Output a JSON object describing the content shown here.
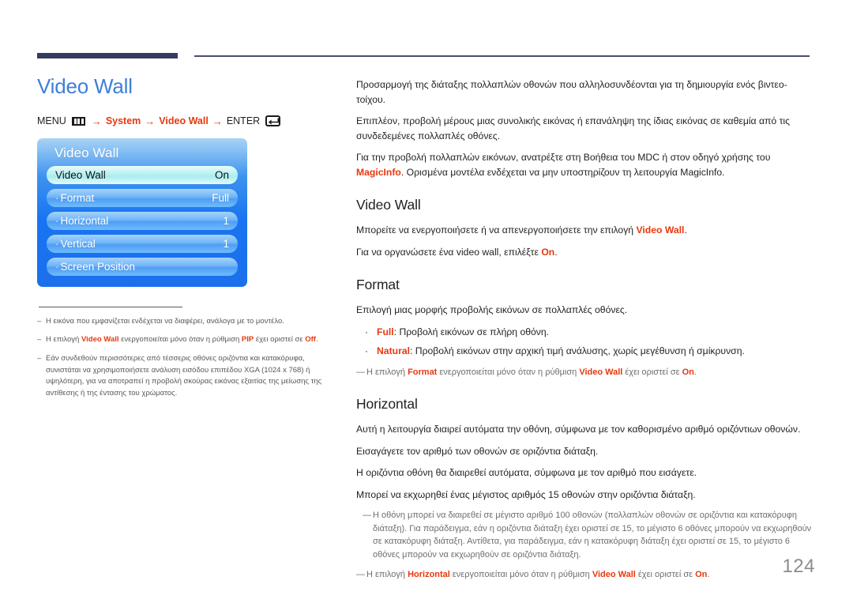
{
  "page": {
    "number": "124",
    "title": "Video Wall",
    "accent_blue": "#3f7fd8",
    "accent_red": "#e8380d",
    "rule_navy": "#353b5e"
  },
  "breadcrumb": {
    "menu_label": "MENU",
    "menu_icon": "menu-bars-icon",
    "arrow": "→",
    "system_label": "System",
    "videowall_label": "Video Wall",
    "enter_label": "ENTER",
    "enter_icon": "enter-return-icon"
  },
  "osd": {
    "title": "Video Wall",
    "rows": [
      {
        "label": "Video Wall",
        "value": "On",
        "selected": true,
        "prefix": ""
      },
      {
        "label": "Format",
        "value": "Full",
        "selected": false,
        "prefix": "·"
      },
      {
        "label": "Horizontal",
        "value": "1",
        "selected": false,
        "prefix": "·"
      },
      {
        "label": "Vertical",
        "value": "1",
        "selected": false,
        "prefix": "·"
      },
      {
        "label": "Screen Position",
        "value": "",
        "selected": false,
        "prefix": "·"
      }
    ]
  },
  "left_footnotes": [
    {
      "dash": "–",
      "parts": [
        {
          "t": "Η εικόνα που εμφανίζεται ενδέχεται να διαφέρει, ανάλογα με το μοντέλο.",
          "hl": false
        }
      ]
    },
    {
      "dash": "–",
      "parts": [
        {
          "t": "Η επιλογή ",
          "hl": false
        },
        {
          "t": "Video Wall",
          "hl": true
        },
        {
          "t": " ενεργοποιείται μόνο όταν η ρύθμιση ",
          "hl": false
        },
        {
          "t": "PIP",
          "hl": true
        },
        {
          "t": " έχει οριστεί σε ",
          "hl": false
        },
        {
          "t": "Off",
          "hl": true
        },
        {
          "t": ".",
          "hl": false
        }
      ]
    },
    {
      "dash": "–",
      "parts": [
        {
          "t": "Εάν συνδεθούν περισσότερες από τέσσερις οθόνες οριζόντια και κατακόρυφα, συνιστάται να χρησιμοποιήσετε ανάλυση εισόδου επιπέδου XGA (1024 x 768) ή υψηλότερη, για να αποτραπεί η προβολή σκούρας εικόνας εξαιτίας της μείωσης της αντίθεσης ή της έντασης του χρώματος.",
          "hl": false
        }
      ]
    }
  ],
  "intro": [
    {
      "parts": [
        {
          "t": "Προσαρμογή της διάταξης πολλαπλών οθονών που αλληλοσυνδέονται για τη δημιουργία ενός βιντεο-τοίχου.",
          "hl": false
        }
      ]
    },
    {
      "parts": [
        {
          "t": "Επιπλέον, προβολή μέρους μιας συνολικής εικόνας ή επανάληψη της ίδιας εικόνας σε καθεμία από τις συνδεδεμένες πολλαπλές οθόνες.",
          "hl": false
        }
      ]
    },
    {
      "parts": [
        {
          "t": "Για την προβολή πολλαπλών εικόνων, ανατρέξτε στη Βοήθεια του MDC ή στον οδηγό χρήσης του ",
          "hl": false
        },
        {
          "t": "MagicInfo",
          "hl": true
        },
        {
          "t": ". Ορισμένα μοντέλα ενδέχεται να μην υποστηρίζουν τη λειτουργία MagicInfo.",
          "hl": false
        }
      ]
    }
  ],
  "sections": [
    {
      "heading": "Video Wall",
      "paragraphs": [
        {
          "parts": [
            {
              "t": "Μπορείτε να ενεργοποιήσετε ή να απενεργοποιήσετε την επιλογή ",
              "hl": false
            },
            {
              "t": "Video Wall",
              "hl": true
            },
            {
              "t": ".",
              "hl": false
            }
          ]
        },
        {
          "parts": [
            {
              "t": "Για να οργανώσετε ένα video wall, επιλέξτε ",
              "hl": false
            },
            {
              "t": "On",
              "hl": true
            },
            {
              "t": ".",
              "hl": false
            }
          ]
        }
      ],
      "bullets": [],
      "notes": []
    },
    {
      "heading": "Format",
      "paragraphs": [
        {
          "parts": [
            {
              "t": "Επιλογή μιας μορφής προβολής εικόνων σε πολλαπλές οθόνες.",
              "hl": false
            }
          ]
        }
      ],
      "bullets": [
        {
          "marker": "·",
          "parts": [
            {
              "t": "Full",
              "hl": true
            },
            {
              "t": ": Προβολή εικόνων σε πλήρη οθόνη.",
              "hl": false
            }
          ]
        },
        {
          "marker": "·",
          "parts": [
            {
              "t": "Natural",
              "hl": true
            },
            {
              "t": ": Προβολή εικόνων στην αρχική τιμή ανάλυσης, χωρίς μεγέθυνση ή σμίκρυνση.",
              "hl": false
            }
          ]
        }
      ],
      "notes": [
        {
          "dash": "—",
          "indent": false,
          "parts": [
            {
              "t": "Η επιλογή ",
              "hl": false
            },
            {
              "t": "Format",
              "hl": true
            },
            {
              "t": " ενεργοποιείται μόνο όταν η ρύθμιση ",
              "hl": false
            },
            {
              "t": "Video Wall",
              "hl": true
            },
            {
              "t": " έχει οριστεί σε ",
              "hl": false
            },
            {
              "t": "On",
              "hl": true
            },
            {
              "t": ".",
              "hl": false
            }
          ]
        }
      ]
    },
    {
      "heading": "Horizontal",
      "paragraphs": [
        {
          "parts": [
            {
              "t": "Αυτή η λειτουργία διαιρεί αυτόματα την οθόνη, σύμφωνα με τον καθορισμένο αριθμό οριζόντιων οθονών.",
              "hl": false
            }
          ]
        },
        {
          "parts": [
            {
              "t": "Εισαγάγετε τον αριθμό των οθονών σε οριζόντια διάταξη.",
              "hl": false
            }
          ]
        },
        {
          "parts": [
            {
              "t": "Η οριζόντια οθόνη θα διαιρεθεί αυτόματα, σύμφωνα με τον αριθμό που εισάγετε.",
              "hl": false
            }
          ]
        },
        {
          "parts": [
            {
              "t": "Μπορεί να εκχωρηθεί ένας μέγιστος αριθμός 15 οθονών στην οριζόντια διάταξη.",
              "hl": false
            }
          ]
        }
      ],
      "bullets": [],
      "notes": [
        {
          "dash": "—",
          "indent": true,
          "parts": [
            {
              "t": "Η οθόνη μπορεί να διαιρεθεί σε μέγιστο αριθμό 100 οθονών (πολλαπλών οθονών σε οριζόντια και κατακόρυφη διάταξη). Για παράδειγμα, εάν η οριζόντια διάταξη έχει οριστεί σε 15, το μέγιστο 6 οθόνες μπορούν να εκχωρηθούν σε κατακόρυφη διάταξη. Αντίθετα, για παράδειγμα, εάν η κατακόρυφη διάταξη έχει οριστεί σε 15, το μέγιστο 6 οθόνες μπορούν να εκχωρηθούν σε οριζόντια διάταξη.",
              "hl": false
            }
          ]
        },
        {
          "dash": "—",
          "indent": false,
          "parts": [
            {
              "t": "Η επιλογή ",
              "hl": false
            },
            {
              "t": "Horizontal",
              "hl": true
            },
            {
              "t": " ενεργοποιείται μόνο όταν η ρύθμιση ",
              "hl": false
            },
            {
              "t": "Video Wall",
              "hl": true
            },
            {
              "t": " έχει οριστεί σε ",
              "hl": false
            },
            {
              "t": "On",
              "hl": true
            },
            {
              "t": ".",
              "hl": false
            }
          ]
        }
      ]
    }
  ]
}
